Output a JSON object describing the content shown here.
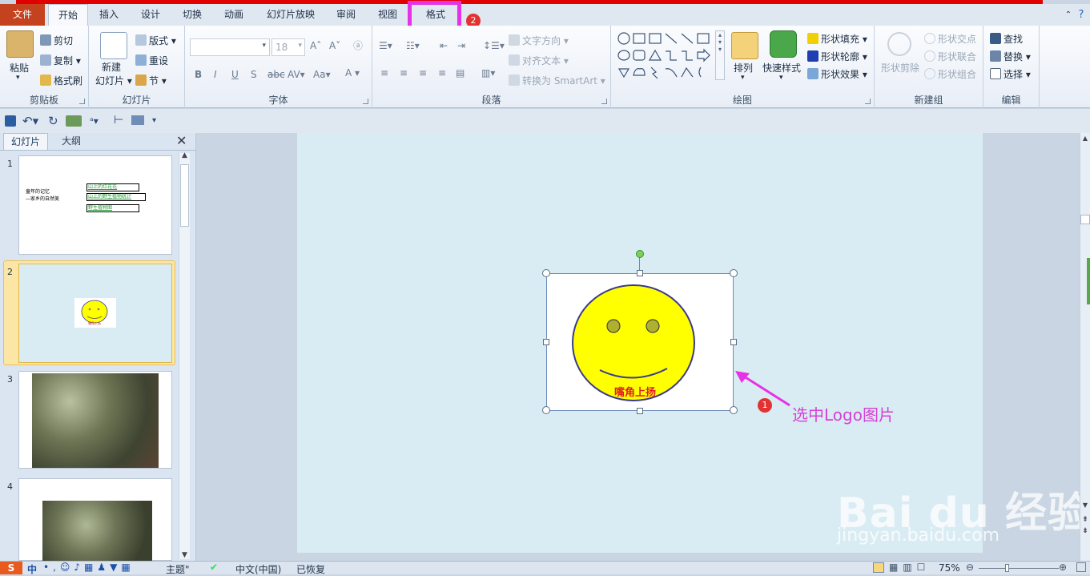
{
  "ribbon_tabs": {
    "file": "文件",
    "home": "开始",
    "insert": "插入",
    "design": "设计",
    "transitions": "切换",
    "animations": "动画",
    "slideshow": "幻灯片放映",
    "review": "审阅",
    "view": "视图",
    "format": "格式"
  },
  "clipboard": {
    "paste": "粘贴",
    "cut": "剪切",
    "copy": "复制",
    "format_painter": "格式刷",
    "label": "剪贴板"
  },
  "slides_group": {
    "new_slide_1": "新建",
    "new_slide_2": "幻灯片",
    "layout": "版式",
    "reset": "重设",
    "section": "节",
    "label": "幻灯片"
  },
  "font": {
    "size": "18",
    "label": "字体",
    "bold": "B",
    "italic": "I",
    "underline": "U",
    "shadow": "S",
    "strike": "abc",
    "spacing": "AV",
    "case": "Aa",
    "color": "A"
  },
  "paragraph": {
    "text_direction": "文字方向",
    "align_text": "对齐文本",
    "convert_smartart": "转换为 SmartArt",
    "label": "段落"
  },
  "drawing": {
    "arrange": "排列",
    "quick_styles": "快速样式",
    "shape_fill": "形状填充",
    "shape_outline": "形状轮廓",
    "shape_effects": "形状效果",
    "label": "绘图"
  },
  "new_group": {
    "shape_subtract": "形状剪除",
    "shape_intersect": "形状交点",
    "shape_union": "形状联合",
    "shape_combine": "形状组合",
    "label": "新建组"
  },
  "editing": {
    "find": "查找",
    "replace": "替换",
    "select": "选择",
    "label": "编辑"
  },
  "pane_tabs": {
    "slides": "幻灯片",
    "outline": "大纲"
  },
  "thumbnails": [
    {
      "number": "1",
      "text_left_1": "童年的记忆",
      "text_left_2": "—家乡的自然美",
      "link_1": "山上的红花花",
      "link_2": "山上的野生植物统计",
      "link_3": "野生植物图"
    },
    {
      "number": "2",
      "logo_caption": "嘴角上扬"
    },
    {
      "number": "3"
    },
    {
      "number": "4"
    }
  ],
  "logo": {
    "caption": "嘴角上扬",
    "face_color": "#ffff00",
    "outline_color": "#3a3a8c",
    "caption_color": "#e02020"
  },
  "annotations": {
    "badge_1": "1",
    "badge_2": "2",
    "callout": "选中Logo图片",
    "accent": "#e631e6"
  },
  "watermark": {
    "line1": "Bai du 经验",
    "line2": "jingyan.baidu.com"
  },
  "status": {
    "theme": "主题\"",
    "language": "中文(中国)",
    "recovered": "已恢复",
    "zoom": "75%",
    "ime": "中"
  }
}
